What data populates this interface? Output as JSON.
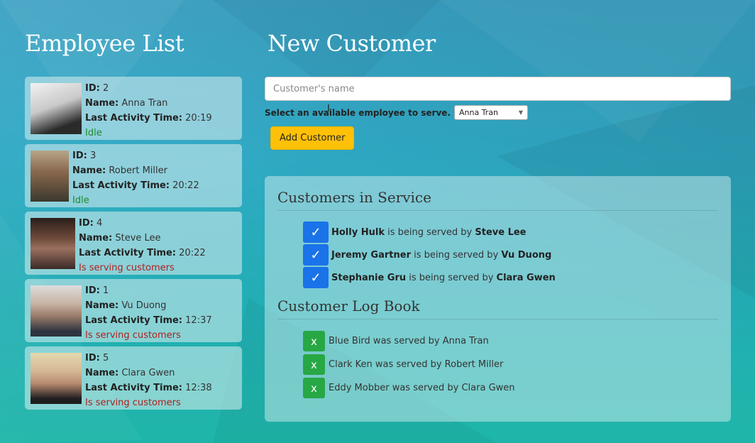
{
  "headings": {
    "employees": "Employee List",
    "new_customer": "New Customer"
  },
  "employees": [
    {
      "id_label": "ID:",
      "id": " 2",
      "name_label": "Name:",
      "name": " Anna Tran",
      "time_label": "Last Activity Time:",
      "time": " 20:19",
      "status": "Idle",
      "status_type": "idle"
    },
    {
      "id_label": "ID:",
      "id": " 3",
      "name_label": "Name:",
      "name": " Robert Miller",
      "time_label": "Last Activity Time:",
      "time": " 20:22",
      "status": "Idle",
      "status_type": "idle"
    },
    {
      "id_label": "ID:",
      "id": " 4",
      "name_label": "Name:",
      "name": " Steve Lee",
      "time_label": "Last Activity Time:",
      "time": " 20:22",
      "status": "Is serving customers",
      "status_type": "busy"
    },
    {
      "id_label": "ID:",
      "id": " 1",
      "name_label": "Name:",
      "name": " Vu Duong",
      "time_label": "Last Activity Time:",
      "time": " 12:37",
      "status": "Is serving customers",
      "status_type": "busy"
    },
    {
      "id_label": "ID:",
      "id": " 5",
      "name_label": "Name:",
      "name": " Clara Gwen",
      "time_label": "Last Activity Time:",
      "time": " 12:38",
      "status": "Is serving customers",
      "status_type": "busy"
    }
  ],
  "form": {
    "name_placeholder": "Customer's name",
    "select_label": "Select an available employee to serve.",
    "selected_employee": "Anna Tran",
    "add_button": "Add Customer"
  },
  "in_service": {
    "title": "Customers in Service",
    "middle_text": " is being served by ",
    "items": [
      {
        "customer": "Holly Hulk",
        "employee": "Steve Lee"
      },
      {
        "customer": "Jeremy Gartner",
        "employee": "Vu Duong"
      },
      {
        "customer": "Stephanie Gru",
        "employee": "Clara Gwen"
      }
    ]
  },
  "log_book": {
    "title": "Customer Log Book",
    "items": [
      "Blue Bird was served by Anna Tran",
      "Clark Ken was served by Robert Miller",
      "Eddy Mobber was served by Clara Gwen"
    ]
  },
  "icons": {
    "check": "check-icon",
    "close": "x-icon"
  },
  "colors": {
    "check_button": "#1a73e8",
    "x_button": "#28a745",
    "add_button": "#ffc107",
    "idle": "#1e8a2b",
    "busy": "#b01f1f"
  }
}
